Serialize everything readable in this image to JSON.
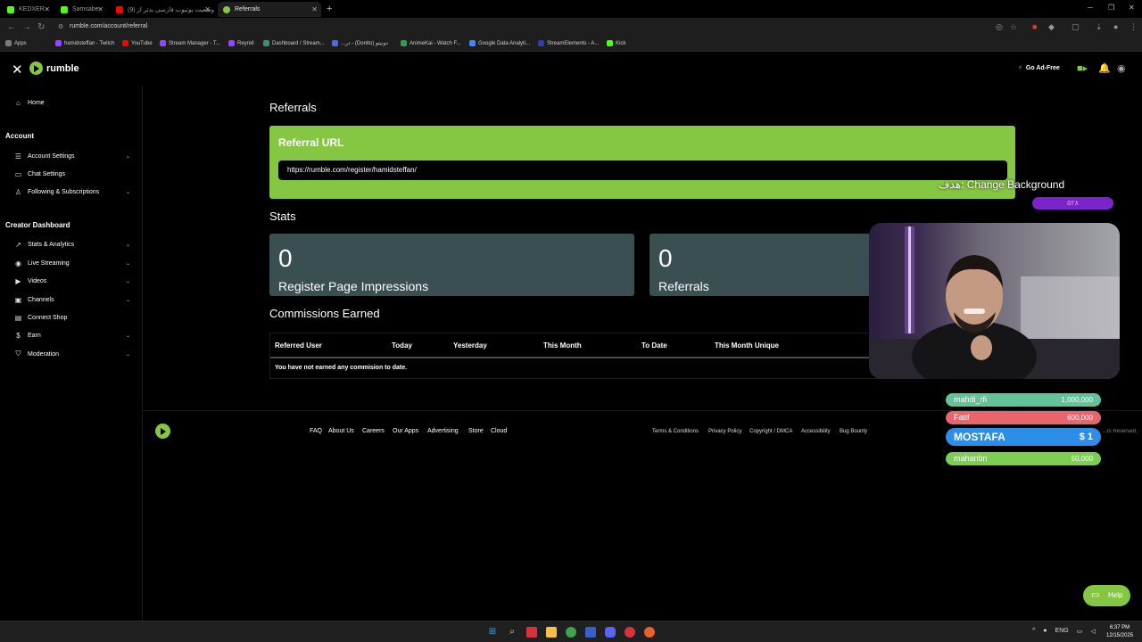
{
  "tabs": [
    {
      "label": "KEDXER",
      "color": "#53fc18"
    },
    {
      "label": "Samsabe",
      "color": "#53fc18"
    },
    {
      "label": "وضعیت یوتیوب فارسی بدتر از (9)",
      "color": "#ff0000"
    },
    {
      "label": "Referrals",
      "color": "#85c742"
    }
  ],
  "address": {
    "url": "rumble.com/account/referral"
  },
  "bookmarks": [
    {
      "label": "Apps",
      "color": "#7a7a7a"
    },
    {
      "label": "hamidsteffan - Twitch",
      "color": "#9146ff"
    },
    {
      "label": "YouTube",
      "color": "#ff0000"
    },
    {
      "label": "Stream Manager - T...",
      "color": "#9146ff"
    },
    {
      "label": "Reyrell",
      "color": "#9146ff"
    },
    {
      "label": "Dashboard / Stream...",
      "color": "#3a8f7a"
    },
    {
      "label": "...در - (Donito) دونیتو",
      "color": "#4a6cd8"
    },
    {
      "label": "AnimeKai - Watch F...",
      "color": "#2ea043"
    },
    {
      "label": "Google Data Analyti...",
      "color": "#4285f4"
    },
    {
      "label": "StreamElements - A...",
      "color": "#2a3dbb"
    },
    {
      "label": "Kick",
      "color": "#53fc18"
    }
  ],
  "header": {
    "logo_text": "rumble",
    "go_ad_free": "Go Ad-Free",
    "brand_color": "#85c742"
  },
  "sidebar": {
    "home": "Home",
    "account_heading": "Account",
    "account_items": [
      {
        "label": "Account Settings"
      },
      {
        "label": "Chat Settings"
      },
      {
        "label": "Following & Subscriptions"
      }
    ],
    "creator_heading": "Creator Dashboard",
    "creator_items": [
      {
        "label": "Stats & Analytics"
      },
      {
        "label": "Live Streaming"
      },
      {
        "label": "Videos"
      },
      {
        "label": "Channels"
      },
      {
        "label": "Connect Shop"
      },
      {
        "label": "Earn"
      },
      {
        "label": "Moderation"
      }
    ]
  },
  "main": {
    "title": "Referrals",
    "referral_card_title": "Referral URL",
    "referral_url": "https://rumble.com/register/hamidsteffan/",
    "stats_title": "Stats",
    "stats": [
      {
        "value": "0",
        "label": "Register Page Impressions"
      },
      {
        "value": "0",
        "label": "Referrals"
      }
    ],
    "commissions_title": "Commissions Earned",
    "columns": [
      "Referred User",
      "Today",
      "Yesterday",
      "This Month",
      "To Date",
      "This Month Unique"
    ],
    "empty_message": "You have not earned any commision to date."
  },
  "footer": {
    "links": [
      "FAQ",
      "About Us",
      "Careers",
      "Our Apps",
      "Advertising",
      "Store",
      "Cloud"
    ],
    "legal": [
      "Terms & Conditions",
      "Privacy Policy",
      "Copyright / DMCA",
      "Accessibility",
      "Bug Bounty"
    ],
    "rights": "...ts Reserved."
  },
  "overlay": {
    "goal_text": "هدف: Change Background",
    "goal_amount": "۵۲۸",
    "donations": [
      {
        "name": "mahdi_rfi",
        "amount": "1,000,000",
        "color": "#63c29a"
      },
      {
        "name": "Fatif",
        "amount": "600,000",
        "color": "#e9656e"
      },
      {
        "name": "MOSTAFA",
        "amount": "$ 1",
        "color": "#2d8ee8"
      },
      {
        "name": "mahanbn",
        "amount": "50,000",
        "color": "#7ccf52"
      }
    ]
  },
  "help": {
    "label": "Help"
  },
  "taskbar": {
    "lang": "ENG",
    "time": "6:37 PM",
    "date": "12/15/2025"
  }
}
